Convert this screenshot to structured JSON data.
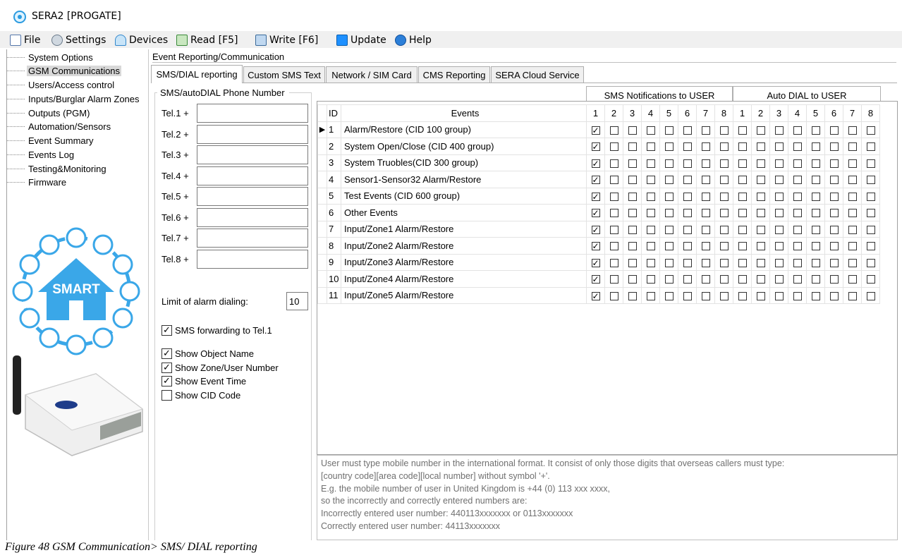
{
  "window": {
    "title": "SERA2 [PROGATE]"
  },
  "menu": [
    {
      "label": "File",
      "icon": "file-icon"
    },
    {
      "label": "Settings",
      "icon": "settings-icon"
    },
    {
      "label": "Devices",
      "icon": "devices-icon"
    },
    {
      "label": "Read [F5]",
      "icon": "read-icon"
    },
    {
      "label": "Write [F6]",
      "icon": "write-icon"
    },
    {
      "label": "Update",
      "icon": "update-icon"
    },
    {
      "label": "Help",
      "icon": "help-icon"
    }
  ],
  "sidebar": {
    "items": [
      {
        "label": "System Options",
        "selected": false
      },
      {
        "label": "GSM Communications",
        "selected": true
      },
      {
        "label": "Users/Access control",
        "selected": false
      },
      {
        "label": "Inputs/Burglar Alarm Zones",
        "selected": false
      },
      {
        "label": "Outputs (PGM)",
        "selected": false
      },
      {
        "label": "Automation/Sensors",
        "selected": false
      },
      {
        "label": "Event Summary",
        "selected": false
      },
      {
        "label": "Events Log",
        "selected": false
      },
      {
        "label": "Testing&Monitoring",
        "selected": false
      },
      {
        "label": "Firmware",
        "selected": false
      }
    ],
    "logo_text": "SMART"
  },
  "section": {
    "title": "Event Reporting/Communication"
  },
  "tabs": [
    {
      "label": "SMS/DIAL reporting",
      "active": true
    },
    {
      "label": "Custom SMS Text",
      "active": false
    },
    {
      "label": "Network / SIM Card",
      "active": false
    },
    {
      "label": "CMS Reporting",
      "active": false
    },
    {
      "label": "SERA Cloud Service",
      "active": false
    }
  ],
  "phone": {
    "group_title": "SMS/autoDIAL Phone Number",
    "tels": [
      {
        "label": "Tel.1  +",
        "value": ""
      },
      {
        "label": "Tel.2  +",
        "value": ""
      },
      {
        "label": "Tel.3  +",
        "value": ""
      },
      {
        "label": "Tel.4  +",
        "value": ""
      },
      {
        "label": "Tel.5  +",
        "value": ""
      },
      {
        "label": "Tel.6  +",
        "value": ""
      },
      {
        "label": "Tel.7  +",
        "value": ""
      },
      {
        "label": "Tel.8  +",
        "value": ""
      }
    ],
    "limit_label": "Limit of alarm dialing:",
    "limit_value": "10",
    "sms_forwarding": {
      "label": "SMS forwarding to Tel.1",
      "checked": true
    },
    "options": [
      {
        "label": "Show Object Name",
        "checked": true
      },
      {
        "label": "Show Zone/User Number",
        "checked": true
      },
      {
        "label": "Show Event Time",
        "checked": true
      },
      {
        "label": "Show CID Code",
        "checked": false
      }
    ]
  },
  "grid": {
    "group_sms": "SMS Notifications to USER",
    "group_dial": "Auto DIAL to USER",
    "col_id": "ID",
    "col_events": "Events",
    "sms_cols": [
      "1",
      "2",
      "3",
      "4",
      "5",
      "6",
      "7",
      "8"
    ],
    "dial_cols": [
      "1",
      "2",
      "3",
      "4",
      "5",
      "6",
      "7",
      "8"
    ],
    "rows": [
      {
        "id": "1",
        "event": "Alarm/Restore (CID 100 group)",
        "sms": [
          1,
          0,
          0,
          0,
          0,
          0,
          0,
          0
        ],
        "dial": [
          0,
          0,
          0,
          0,
          0,
          0,
          0,
          0
        ]
      },
      {
        "id": "2",
        "event": "System Open/Close (CID 400 group)",
        "sms": [
          1,
          0,
          0,
          0,
          0,
          0,
          0,
          0
        ],
        "dial": [
          0,
          0,
          0,
          0,
          0,
          0,
          0,
          0
        ]
      },
      {
        "id": "3",
        "event": "System Truobles(CID 300 group)",
        "sms": [
          1,
          0,
          0,
          0,
          0,
          0,
          0,
          0
        ],
        "dial": [
          0,
          0,
          0,
          0,
          0,
          0,
          0,
          0
        ]
      },
      {
        "id": "4",
        "event": "Sensor1-Sensor32 Alarm/Restore",
        "sms": [
          1,
          0,
          0,
          0,
          0,
          0,
          0,
          0
        ],
        "dial": [
          0,
          0,
          0,
          0,
          0,
          0,
          0,
          0
        ]
      },
      {
        "id": "5",
        "event": "Test Events (CID 600 group)",
        "sms": [
          1,
          0,
          0,
          0,
          0,
          0,
          0,
          0
        ],
        "dial": [
          0,
          0,
          0,
          0,
          0,
          0,
          0,
          0
        ]
      },
      {
        "id": "6",
        "event": "Other Events",
        "sms": [
          1,
          0,
          0,
          0,
          0,
          0,
          0,
          0
        ],
        "dial": [
          0,
          0,
          0,
          0,
          0,
          0,
          0,
          0
        ]
      },
      {
        "id": "7",
        "event": "Input/Zone1 Alarm/Restore",
        "sms": [
          1,
          0,
          0,
          0,
          0,
          0,
          0,
          0
        ],
        "dial": [
          0,
          0,
          0,
          0,
          0,
          0,
          0,
          0
        ]
      },
      {
        "id": "8",
        "event": "Input/Zone2 Alarm/Restore",
        "sms": [
          1,
          0,
          0,
          0,
          0,
          0,
          0,
          0
        ],
        "dial": [
          0,
          0,
          0,
          0,
          0,
          0,
          0,
          0
        ]
      },
      {
        "id": "9",
        "event": "Input/Zone3 Alarm/Restore",
        "sms": [
          1,
          0,
          0,
          0,
          0,
          0,
          0,
          0
        ],
        "dial": [
          0,
          0,
          0,
          0,
          0,
          0,
          0,
          0
        ]
      },
      {
        "id": "10",
        "event": "Input/Zone4 Alarm/Restore",
        "sms": [
          1,
          0,
          0,
          0,
          0,
          0,
          0,
          0
        ],
        "dial": [
          0,
          0,
          0,
          0,
          0,
          0,
          0,
          0
        ]
      },
      {
        "id": "11",
        "event": "Input/Zone5 Alarm/Restore",
        "sms": [
          1,
          0,
          0,
          0,
          0,
          0,
          0,
          0
        ],
        "dial": [
          0,
          0,
          0,
          0,
          0,
          0,
          0,
          0
        ]
      }
    ]
  },
  "info": {
    "lines": [
      "User must type mobile number in the international format. It consist of only those digits that overseas callers must type:",
      "[country code][area code][local number] without symbol '+'.",
      "E.g. the mobile number of user in United Kingdom is +44 (0) 113 xxx xxxx,",
      "so the incorrectly and correctly entered numbers are:",
      "Incorrectly entered user number: 440113xxxxxxx or 0113xxxxxxx",
      "Correctly entered user number: 44113xxxxxxx"
    ]
  },
  "caption": "Figure 48 GSM Communication> SMS/ DIAL reporting",
  "colors": {
    "accent": "#2b9be0",
    "logo_blue": "#3aa7e8"
  }
}
